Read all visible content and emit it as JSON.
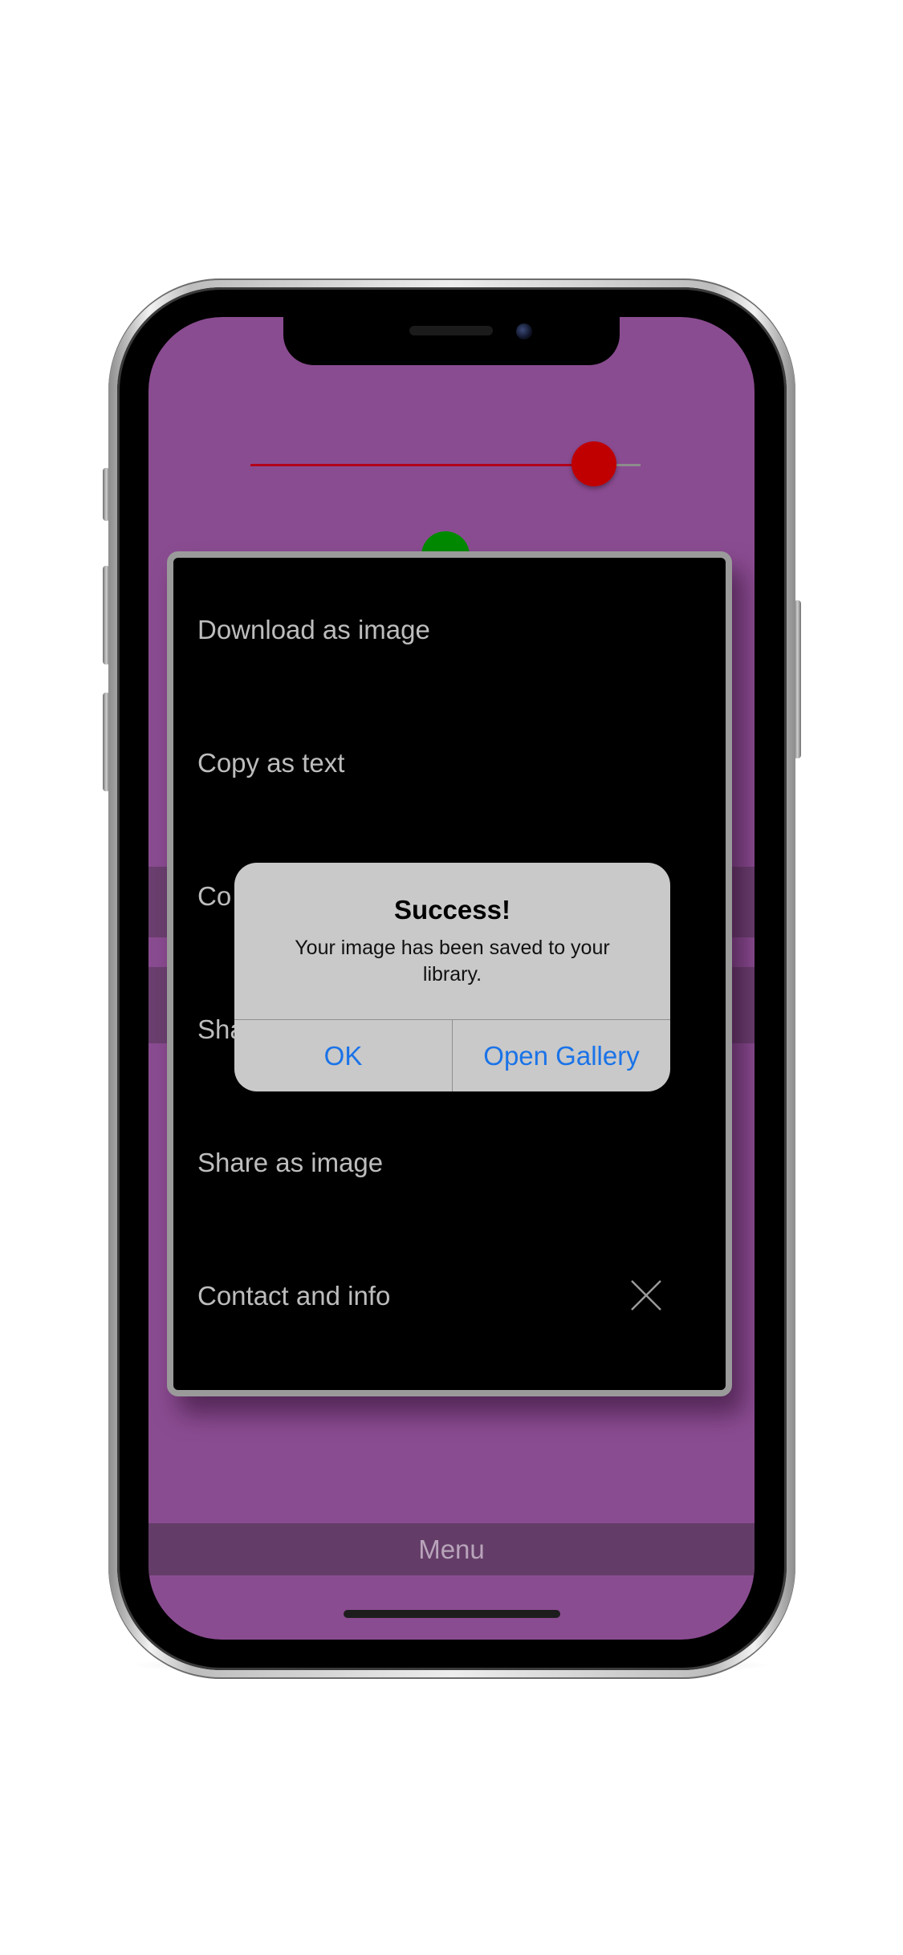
{
  "slider": {
    "level": 0.88,
    "fill_color": "#b3001a",
    "thumb_color": "#c00000"
  },
  "menu": {
    "items": [
      {
        "label": "Download as image"
      },
      {
        "label": "Copy as text"
      },
      {
        "label": "Co"
      },
      {
        "label": "Sha"
      },
      {
        "label": "Share as image"
      },
      {
        "label": "Contact and info"
      }
    ],
    "close_icon": "close-icon"
  },
  "alert": {
    "title": "Success!",
    "message": "Your image has been saved to your library.",
    "buttons": [
      {
        "label": "OK"
      },
      {
        "label": "Open Gallery"
      }
    ]
  },
  "bottom_bar": {
    "label": "Menu"
  },
  "colors": {
    "background": "#8a4c91",
    "panel": "#000000",
    "accent_button": "#1a73e8",
    "green_dot": "#008a00"
  }
}
